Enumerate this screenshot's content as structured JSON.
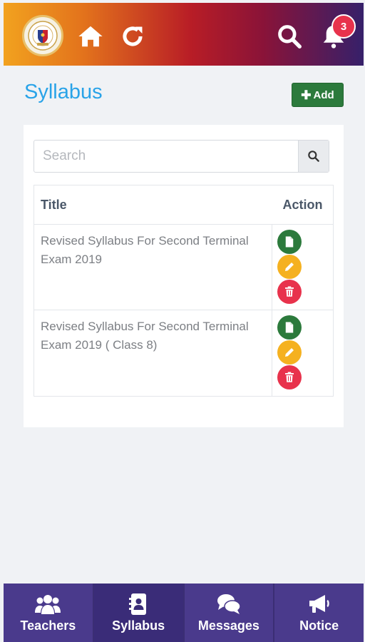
{
  "header": {
    "notification_count": "3",
    "icons": [
      "school-logo",
      "home-icon",
      "refresh-icon",
      "search-icon",
      "bell-icon"
    ]
  },
  "page": {
    "title": "Syllabus",
    "add_label": "Add"
  },
  "search": {
    "placeholder": "Search",
    "value": ""
  },
  "table": {
    "columns": [
      "Title",
      "Action"
    ],
    "rows": [
      {
        "title": "Revised Syllabus For Second Terminal Exam 2019"
      },
      {
        "title": "Revised Syllabus For Second Terminal Exam 2019 ( Class 8)"
      }
    ]
  },
  "bottom_nav": {
    "items": [
      {
        "label": "Teachers",
        "icon": "users-icon"
      },
      {
        "label": "Syllabus",
        "icon": "contact-book-icon"
      },
      {
        "label": "Messages",
        "icon": "chat-icon"
      },
      {
        "label": "Notice",
        "icon": "megaphone-icon"
      }
    ],
    "active": "Syllabus"
  },
  "colors": {
    "accent": "#29a3e8",
    "nav_bg": "#4a3a8c",
    "view": "#2c7a3c",
    "edit": "#f5b120",
    "delete": "#e8324c"
  }
}
